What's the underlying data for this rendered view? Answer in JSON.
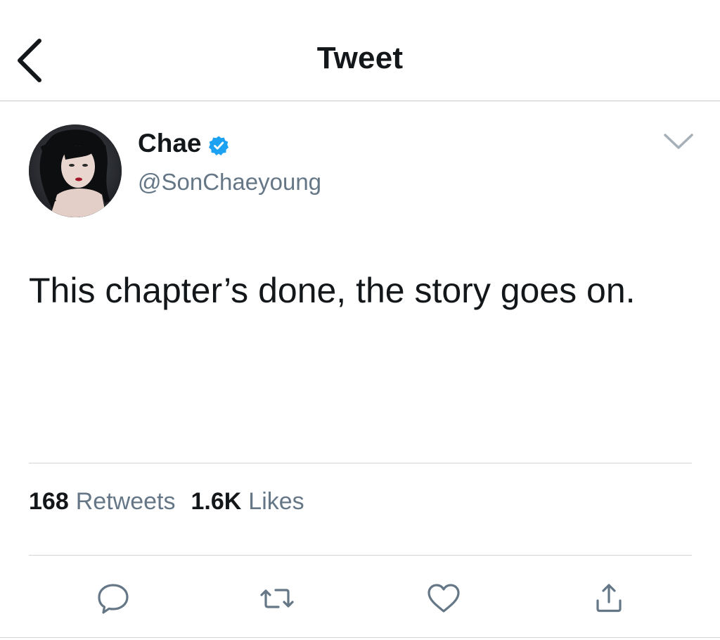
{
  "header": {
    "title": "Tweet",
    "back_icon": "chevron-left-icon"
  },
  "tweet": {
    "author": {
      "display_name": "Chae",
      "handle": "@SonChaeyoung",
      "verified": true,
      "verified_color": "#1da1f2"
    },
    "text": "This chapter’s done, the story goes on.",
    "stats": {
      "retweets_count": "168",
      "retweets_label": "Retweets",
      "likes_count": "1.6K",
      "likes_label": "Likes"
    },
    "actions": [
      {
        "name": "reply",
        "icon": "comment-icon"
      },
      {
        "name": "retweet",
        "icon": "retweet-icon"
      },
      {
        "name": "like",
        "icon": "heart-icon"
      },
      {
        "name": "share",
        "icon": "share-icon"
      }
    ]
  },
  "colors": {
    "text_primary": "#14171a",
    "text_secondary": "#657786",
    "icon_gray": "#657786",
    "divider": "#d3d6d9"
  }
}
